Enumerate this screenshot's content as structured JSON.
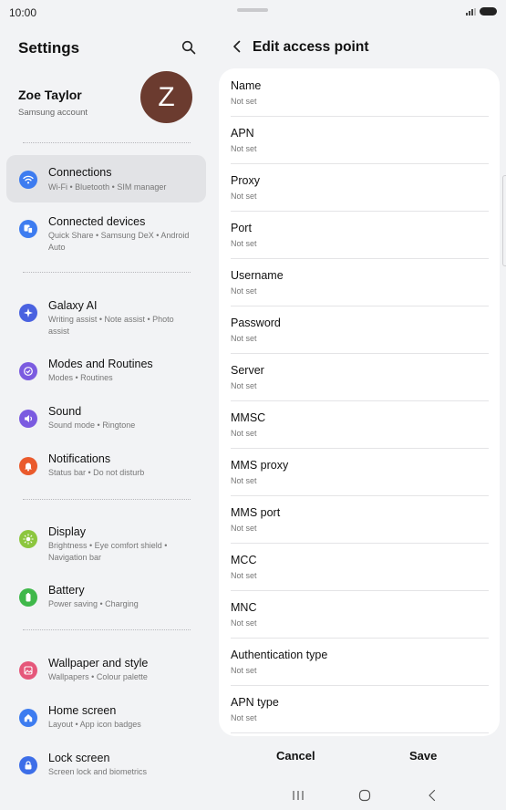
{
  "status_bar": {
    "time": "10:00"
  },
  "settings": {
    "title": "Settings",
    "profile": {
      "name": "Zoe Taylor",
      "subtitle": "Samsung account",
      "avatar_letter": "Z",
      "avatar_color": "#6b3b2f"
    },
    "menu": [
      {
        "title": "Connections",
        "subtitle": "Wi-Fi  •  Bluetooth  •  SIM manager",
        "icon": "wifi-icon",
        "color": "#3d7cf0",
        "selected": true
      },
      {
        "title": "Connected devices",
        "subtitle": "Quick Share  •  Samsung DeX  •  Android Auto",
        "icon": "devices-icon",
        "color": "#3d7cf0"
      },
      {
        "title": "Galaxy AI",
        "subtitle": "Writing assist  •  Note assist  •  Photo assist",
        "icon": "sparkle-icon",
        "color": "#4a62e0"
      },
      {
        "title": "Modes and Routines",
        "subtitle": "Modes  •  Routines",
        "icon": "modes-icon",
        "color": "#7b5be0"
      },
      {
        "title": "Sound",
        "subtitle": "Sound mode  •  Ringtone",
        "icon": "sound-icon",
        "color": "#7b5be0"
      },
      {
        "title": "Notifications",
        "subtitle": "Status bar  •  Do not disturb",
        "icon": "bell-icon",
        "color": "#ea5a2c"
      },
      {
        "title": "Display",
        "subtitle": "Brightness  •  Eye comfort shield  •  Navigation bar",
        "icon": "sun-icon",
        "color": "#8cc63e"
      },
      {
        "title": "Battery",
        "subtitle": "Power saving  •  Charging",
        "icon": "battery-icon",
        "color": "#3fb84a"
      },
      {
        "title": "Wallpaper and style",
        "subtitle": "Wallpapers  •  Colour palette",
        "icon": "wallpaper-icon",
        "color": "#e5577a"
      },
      {
        "title": "Home screen",
        "subtitle": "Layout  •  App icon badges",
        "icon": "home-icon",
        "color": "#3d7cf0"
      },
      {
        "title": "Lock screen",
        "subtitle": "Screen lock and biometrics",
        "icon": "lock-icon",
        "color": "#3d6ee8"
      }
    ]
  },
  "apn": {
    "title": "Edit access point",
    "fields": [
      {
        "label": "Name",
        "value": "Not set"
      },
      {
        "label": "APN",
        "value": "Not set"
      },
      {
        "label": "Proxy",
        "value": "Not set"
      },
      {
        "label": "Port",
        "value": "Not set"
      },
      {
        "label": "Username",
        "value": "Not set"
      },
      {
        "label": "Password",
        "value": "Not set"
      },
      {
        "label": "Server",
        "value": "Not set"
      },
      {
        "label": "MMSC",
        "value": "Not set"
      },
      {
        "label": "MMS proxy",
        "value": "Not set"
      },
      {
        "label": "MMS port",
        "value": "Not set"
      },
      {
        "label": "MCC",
        "value": "Not set"
      },
      {
        "label": "MNC",
        "value": "Not set"
      },
      {
        "label": "Authentication type",
        "value": "Not set"
      },
      {
        "label": "APN type",
        "value": "Not set"
      }
    ],
    "cancel_label": "Cancel",
    "save_label": "Save"
  }
}
